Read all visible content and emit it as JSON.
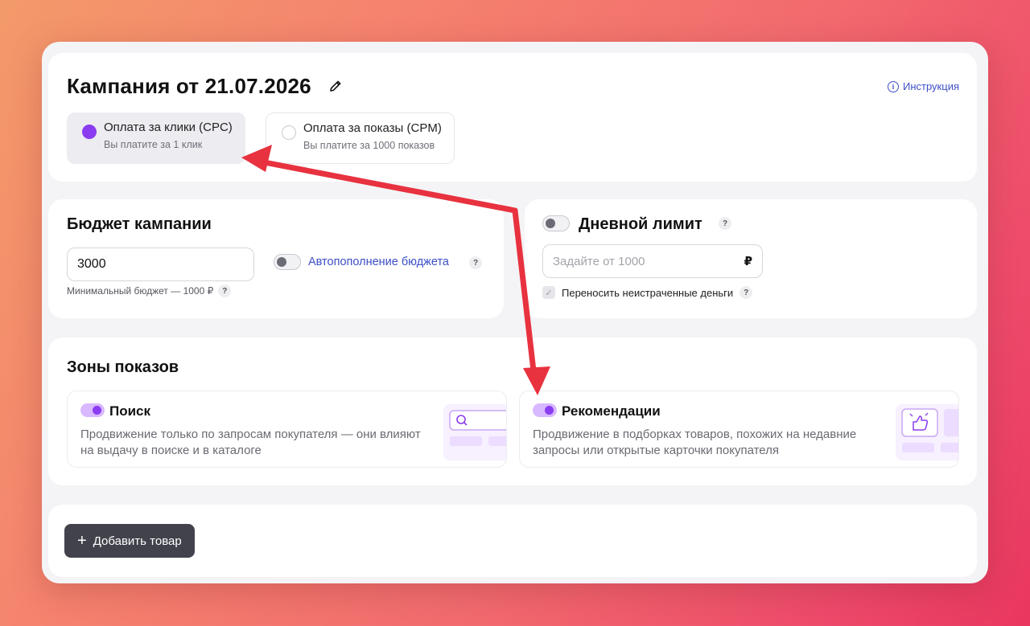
{
  "campaign": {
    "title": "Кампания от 21.07.2026",
    "instruction_link": "Инструкция"
  },
  "payment_options": [
    {
      "title": "Оплата за клики (CPC)",
      "subtitle": "Вы платите за 1 клик",
      "selected": true
    },
    {
      "title": "Оплата за показы (CPM)",
      "subtitle": "Вы платите за 1000 показов",
      "selected": false
    }
  ],
  "budget": {
    "heading": "Бюджет кампании",
    "value": "3000",
    "auto_topup_label": "Автопополнение бюджета",
    "auto_topup_enabled": false,
    "min_hint": "Минимальный бюджет — 1000 ₽"
  },
  "daily_limit": {
    "heading": "Дневной лимит",
    "enabled": false,
    "placeholder": "Задайте от 1000",
    "currency": "₽",
    "carryover_label": "Переносить неистраченные деньги",
    "carryover_checked": true
  },
  "zones": {
    "heading": "Зоны показов",
    "items": [
      {
        "title": "Поиск",
        "description": "Продвижение только по запросам покупателя — они влияют на выдачу в поиске и в каталоге",
        "enabled": true
      },
      {
        "title": "Рекомендации",
        "description": "Продвижение в подборках товаров, похожих на недавние запросы или открытые карточки покупателя",
        "enabled": true
      }
    ]
  },
  "actions": {
    "add_product_label": "Добавить товар"
  },
  "colors": {
    "accent": "#8a3cf0",
    "link": "#3d4fc6",
    "arrow": "#e8323f",
    "button_dark": "#42424c"
  }
}
